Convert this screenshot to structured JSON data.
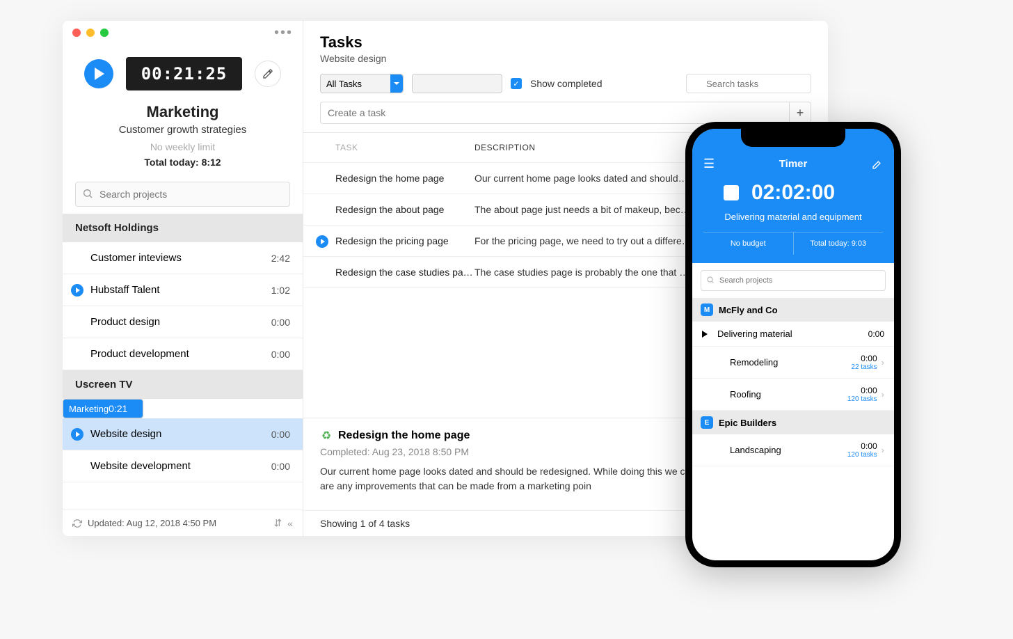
{
  "desktop": {
    "timer": "00:21:25",
    "current_project": "Marketing",
    "current_desc": "Customer growth strategies",
    "limit_text": "No weekly limit",
    "total_today_label": "Total today: 8:12",
    "search_placeholder": "Search projects",
    "orgs": [
      {
        "name": "Netsoft Holdings",
        "projects": [
          {
            "name": "Customer inteviews",
            "time": "2:42",
            "state": ""
          },
          {
            "name": "Hubstaff Talent",
            "time": "1:02",
            "state": "play"
          },
          {
            "name": "Product design",
            "time": "0:00",
            "state": ""
          },
          {
            "name": "Product development",
            "time": "0:00",
            "state": ""
          }
        ]
      },
      {
        "name": "Uscreen TV",
        "projects": [
          {
            "name": "Marketing",
            "time": "0:21",
            "state": "sel"
          },
          {
            "name": "Website design",
            "time": "0:00",
            "state": "play hl"
          },
          {
            "name": "Website development",
            "time": "0:00",
            "state": ""
          }
        ]
      }
    ],
    "footer_updated": "Updated: Aug 12, 2018 4:50 PM"
  },
  "main": {
    "title": "Tasks",
    "subtitle": "Website design",
    "filter_all": "All Tasks",
    "show_completed": "Show completed",
    "search_placeholder": "Search tasks",
    "create_placeholder": "Create a task",
    "th_task": "TASK",
    "th_desc": "DESCRIPTION",
    "rows": [
      {
        "task": "Redesign the home page",
        "desc": "Our current home page looks dated and should…",
        "active": false
      },
      {
        "task": "Redesign the about page",
        "desc": "The about page just needs a bit of makeup, bec…",
        "active": false
      },
      {
        "task": "Redesign the pricing page",
        "desc": "For the pricing page, we need to try out a differe…",
        "active": true
      },
      {
        "task": "Redesign the case studies pa…",
        "desc": "The case studies page is probably the one that …",
        "active": false
      }
    ],
    "detail": {
      "title": "Redesign the home page",
      "meta": "Completed: Aug 23, 2018 8:50 PM",
      "body": "Our current home page looks dated and should be redesigned. While doing this we can section and see if there are any improvements that can be made from a marketing poin"
    },
    "footer_count": "Showing 1 of 4 tasks"
  },
  "phone": {
    "title": "Timer",
    "time": "02:02:00",
    "task": "Delivering material and equipment",
    "stat_left": "No budget",
    "stat_right": "Total today: 9:03",
    "search_placeholder": "Search projects",
    "orgs": [
      {
        "badge": "M",
        "name": "McFly and Co",
        "items": [
          {
            "name": "Delivering material",
            "time": "0:00",
            "sub": "",
            "playing": true
          },
          {
            "name": "Remodeling",
            "time": "0:00",
            "sub": "22 tasks",
            "playing": false
          },
          {
            "name": "Roofing",
            "time": "0:00",
            "sub": "120 tasks",
            "playing": false
          }
        ]
      },
      {
        "badge": "E",
        "name": "Epic Builders",
        "items": [
          {
            "name": "Landscaping",
            "time": "0:00",
            "sub": "120 tasks",
            "playing": false
          }
        ]
      }
    ]
  }
}
